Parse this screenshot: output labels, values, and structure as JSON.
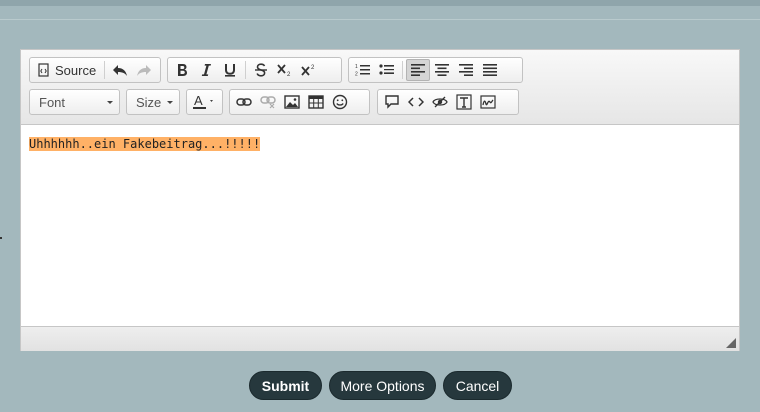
{
  "toolbar": {
    "source_label": "Source",
    "font_label": "Font",
    "size_label": "Size",
    "icons": [
      "undo-icon",
      "redo-icon",
      "bold-icon",
      "italic-icon",
      "underline-icon",
      "strike-icon",
      "subscript-icon",
      "superscript-icon",
      "numbered-list-icon",
      "bulleted-list-icon",
      "align-left-icon",
      "align-center-icon",
      "align-right-icon",
      "justify-icon",
      "text-color-icon",
      "link-icon",
      "unlink-icon",
      "image-icon",
      "table-icon",
      "smiley-icon",
      "blockquote-icon",
      "code-icon",
      "spoiler-icon",
      "text-icon",
      "signature-icon"
    ]
  },
  "editor": {
    "content": "Uhhhhhh..ein Fakebeitrag...!!!!!",
    "highlight_color": "#ffb166"
  },
  "actions": {
    "submit_label": "Submit",
    "more_options_label": "More Options",
    "cancel_label": "Cancel"
  },
  "colors": {
    "page_bg": "#a3b8bd",
    "button_bg": "#26383d"
  }
}
